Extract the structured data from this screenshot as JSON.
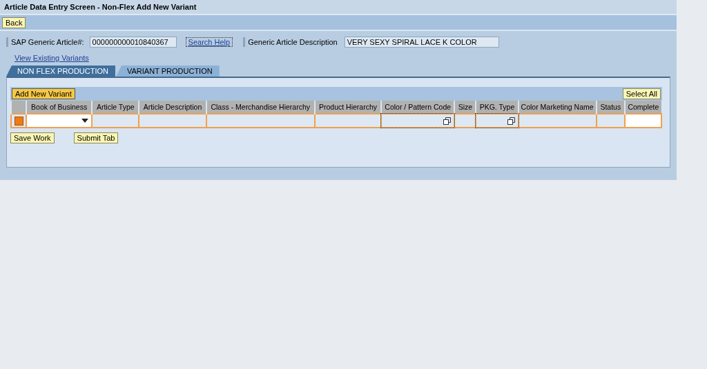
{
  "window": {
    "title": "Article Data Entry Screen - Non-Flex Add New Variant"
  },
  "toolbar": {
    "buttons": [
      "Back"
    ]
  },
  "header": {
    "article_label": "SAP Generic Article#:",
    "article_value": "000000000010840367",
    "search_help": "Search Help",
    "description_label": "Generic Article Description",
    "description_value": "VERY SEXY SPIRAL LACE K COLOR",
    "view_link": "View Existing Variants"
  },
  "tabs": [
    {
      "label": "NON FLEX PRODUCTION",
      "selected": true
    },
    {
      "label": "VARIANT PRODUCTION",
      "selected": false
    }
  ],
  "table": {
    "add_button": "Add New Variant",
    "select_all_button": "Select All",
    "columns": [
      "Book of Business",
      "Article Type",
      "Article Description",
      "Class - Merchandise Hierarchy",
      "Product Hierarchy",
      "Color / Pattern Code",
      "Size",
      "PKG. Type",
      "Color Marketing Name",
      "Status",
      "Complete"
    ],
    "rows": [
      {
        "selected": true,
        "cells": [
          {
            "kind": "dropdown"
          },
          {
            "kind": "plain"
          },
          {
            "kind": "plain"
          },
          {
            "kind": "plain"
          },
          {
            "kind": "plain"
          },
          {
            "kind": "help"
          },
          {
            "kind": "plain"
          },
          {
            "kind": "help"
          },
          {
            "kind": "plain"
          },
          {
            "kind": "plain"
          },
          {
            "kind": "input"
          }
        ]
      }
    ]
  },
  "footer_buttons": [
    "Save Work",
    "Submit Tab"
  ]
}
